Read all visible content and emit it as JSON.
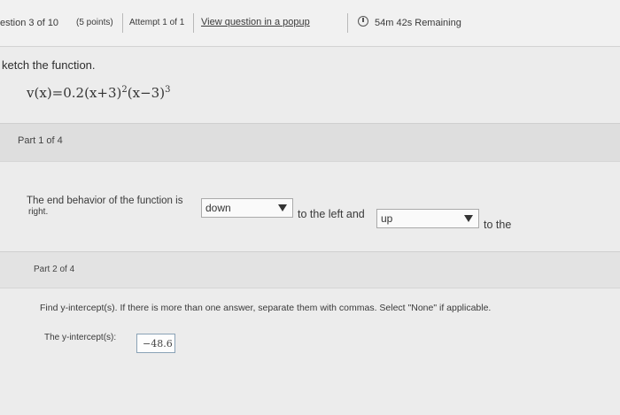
{
  "header": {
    "question_counter": "estion 3 of 10",
    "points": "(5 points)",
    "attempt": "Attempt 1 of 1",
    "popup_link": "View question in a popup",
    "timer": "54m 42s Remaining"
  },
  "question": {
    "prompt": "ketch the function.",
    "function_lhs": "v",
    "function_var": "x",
    "function_coef": "0.2",
    "function_factor1": "x+3",
    "function_exp1": "2",
    "function_factor2": "x−3",
    "function_exp2": "3"
  },
  "part1": {
    "label": "Part 1 of 4",
    "text_before": "The end behavior of the function is",
    "dropdown_left_value": "down",
    "text_middle": "to the left and",
    "dropdown_right_value": "up",
    "text_after": "to the",
    "text_wrap": "right."
  },
  "part2": {
    "label": "Part 2 of 4",
    "instruction": "Find y-intercept(s). If there is more than one answer, separate them with commas. Select \"None\" if applicable.",
    "answer_label": "The y-intercept(s):",
    "answer_value": "−48.6"
  }
}
